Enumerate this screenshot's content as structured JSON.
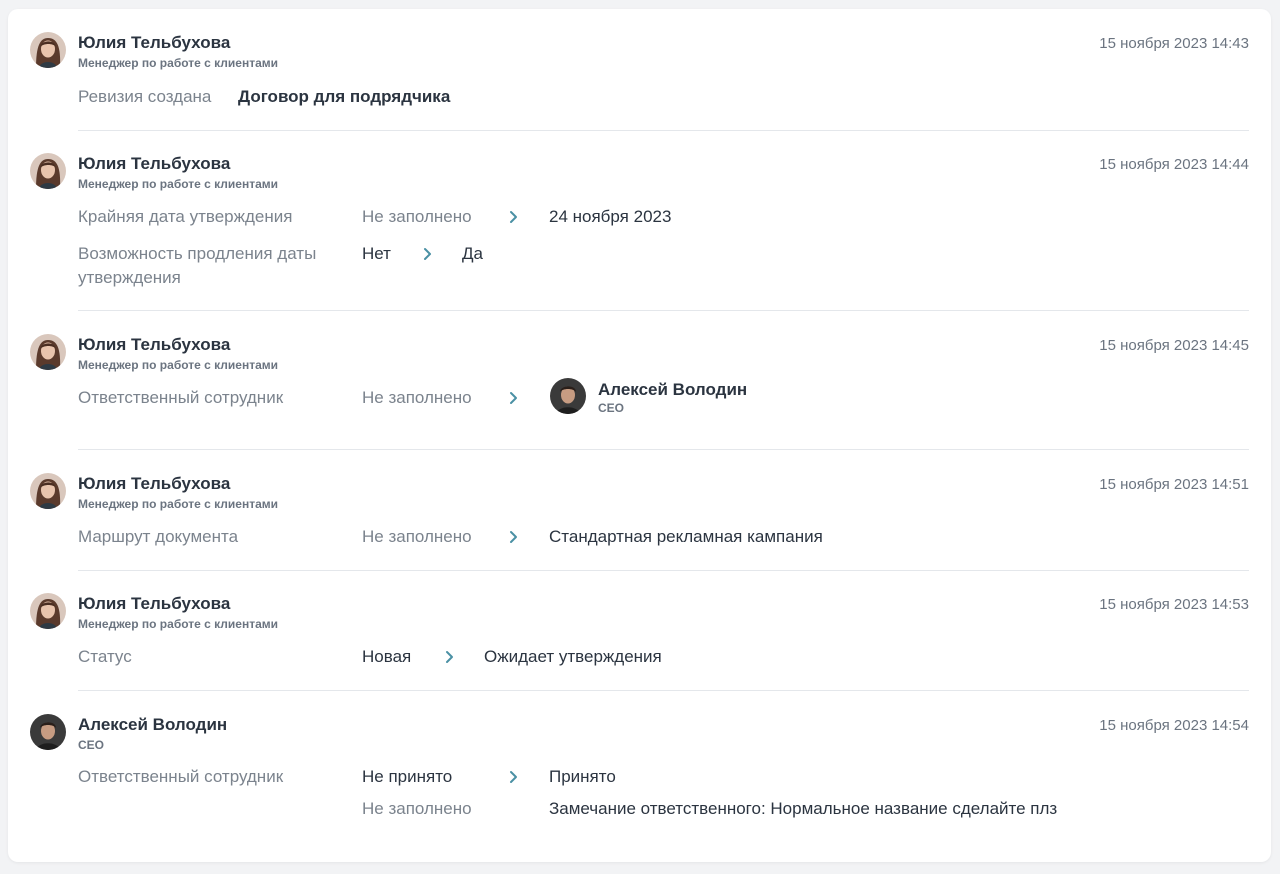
{
  "entries": [
    {
      "author": {
        "name": "Юлия Тельбухова",
        "role": "Менеджер по работе с клиентами"
      },
      "timestamp": "15 ноября 2023 14:43",
      "label": "Ревизия создана",
      "value": "Договор для подрядчика"
    },
    {
      "author": {
        "name": "Юлия Тельбухова",
        "role": "Менеджер по работе с клиентами"
      },
      "timestamp": "15 ноября 2023 14:44",
      "changes": [
        {
          "label": "Крайняя дата утверждения",
          "from": "Не заполнено",
          "to": "24 ноября 2023"
        },
        {
          "label": "Возможность продления даты утверждения",
          "from": "Нет",
          "to": "Да"
        }
      ]
    },
    {
      "author": {
        "name": "Юлия Тельбухова",
        "role": "Менеджер по работе с клиентами"
      },
      "timestamp": "15 ноября 2023 14:45",
      "changes": [
        {
          "label": "Ответственный сотрудник",
          "from": "Не заполнено",
          "to_user": {
            "name": "Алексей Володин",
            "role": "CEO"
          }
        }
      ]
    },
    {
      "author": {
        "name": "Юлия Тельбухова",
        "role": "Менеджер по работе с клиентами"
      },
      "timestamp": "15 ноября 2023 14:51",
      "changes": [
        {
          "label": "Маршрут документа",
          "from": "Не заполнено",
          "to": "Стандартная рекламная кампания"
        }
      ]
    },
    {
      "author": {
        "name": "Юлия Тельбухова",
        "role": "Менеджер по работе с клиентами"
      },
      "timestamp": "15 ноября 2023 14:53",
      "changes": [
        {
          "label": "Статус",
          "from": "Новая",
          "to": "Ожидает утверждения"
        }
      ]
    },
    {
      "author": {
        "name": "Алексей Володин",
        "role": "CEO"
      },
      "timestamp": "15 ноября 2023 14:54",
      "changes": [
        {
          "label": "Ответственный сотрудник",
          "from": "Не принято",
          "to": "Принято",
          "from2": "Не заполнено",
          "to2": "Замечание ответственного: Нормальное название сделайте плз"
        }
      ]
    }
  ],
  "colors": {
    "accent_arrow": "#4a90a4",
    "divider": "#e4e7eb",
    "muted_text": "#7b838d"
  },
  "icons": {
    "arrow": "chevron-right-icon"
  }
}
